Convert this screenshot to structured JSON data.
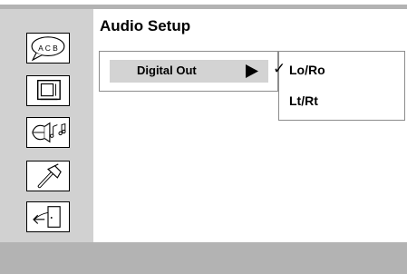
{
  "header": {
    "title": "Audio Setup"
  },
  "sidebar": {
    "items": [
      {
        "icon": "language-speech-bubble-icon",
        "text": "A C B"
      },
      {
        "icon": "tv-screen-icon"
      },
      {
        "icon": "speaker-music-icon"
      },
      {
        "icon": "hammer-tool-icon"
      },
      {
        "icon": "exit-door-icon"
      }
    ]
  },
  "menu": {
    "items": [
      {
        "label": "Digital Out",
        "icon": "arrow-right-icon",
        "selected": true
      }
    ]
  },
  "submenu": {
    "options": [
      {
        "label": "Lo/Ro",
        "checked": true
      },
      {
        "label": "Lt/Rt",
        "checked": false
      }
    ],
    "check_glyph": "✓"
  },
  "colors": {
    "sidebar_bg": "#d1d1d1",
    "bars": "#b3b3b3",
    "highlight": "#d3d3d3"
  }
}
